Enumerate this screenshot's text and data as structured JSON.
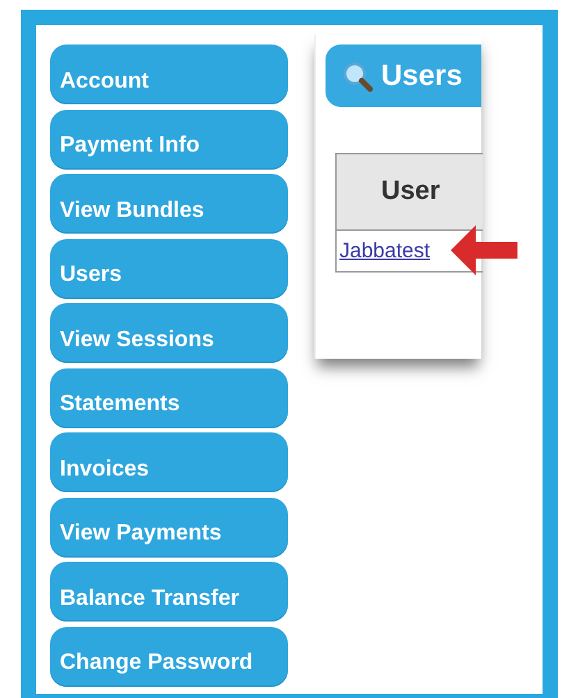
{
  "menu": [
    {
      "label": "Account"
    },
    {
      "label": "Payment Info"
    },
    {
      "label": "View Bundles"
    },
    {
      "label": "Users"
    },
    {
      "label": "View Sessions"
    },
    {
      "label": "Statements"
    },
    {
      "label": "Invoices"
    },
    {
      "label": "View Payments"
    },
    {
      "label": "Balance Transfer"
    },
    {
      "label": "Change Password"
    }
  ],
  "panel": {
    "title": "Users",
    "table": {
      "columns": [
        "User"
      ],
      "rows": [
        {
          "user": "Jabbatest",
          "highlighted": true
        }
      ]
    }
  }
}
